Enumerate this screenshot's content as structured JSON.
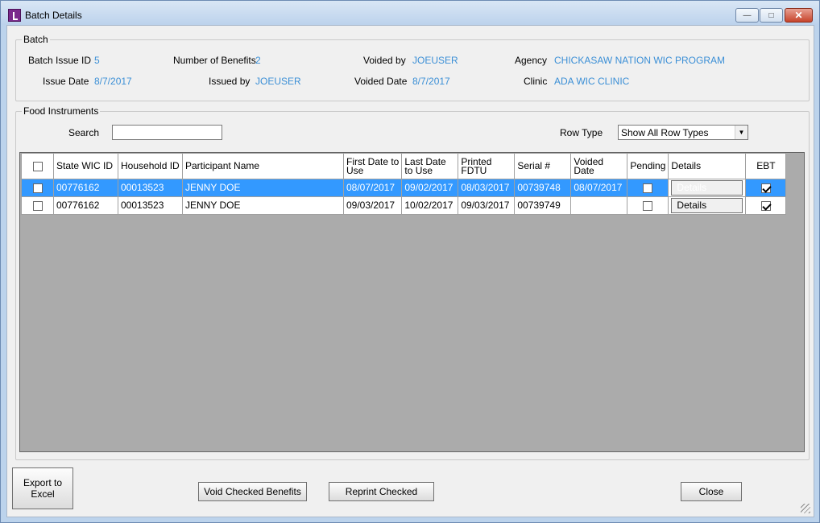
{
  "window": {
    "title": "Batch Details",
    "controls": {
      "minimize": "—",
      "maximize": "□",
      "close": "✕"
    }
  },
  "batch": {
    "group_label": "Batch",
    "batch_issue_id_label": "Batch Issue ID",
    "batch_issue_id": "5",
    "issue_date_label": "Issue Date",
    "issue_date": "8/7/2017",
    "number_of_benefits_label": "Number of Benefits",
    "number_of_benefits": "2",
    "issued_by_label": "Issued by",
    "issued_by": "JOEUSER",
    "voided_by_label": "Voided by",
    "voided_by": "JOEUSER",
    "voided_date_label": "Voided Date",
    "voided_date": "8/7/2017",
    "agency_label": "Agency",
    "agency": "CHICKASAW NATION WIC PROGRAM",
    "clinic_label": "Clinic",
    "clinic": "ADA WIC CLINIC"
  },
  "food_instruments": {
    "group_label": "Food Instruments",
    "search_label": "Search",
    "search_value": "",
    "row_type_label": "Row Type",
    "row_type_selected": "Show All Row Types"
  },
  "table": {
    "columns": {
      "state_wic_id": "State WIC ID",
      "household_id": "Household ID",
      "participant_name": "Participant Name",
      "first_date_to_use_1": "First Date to",
      "first_date_to_use_2": "Use",
      "last_date_to_use_1": "Last Date",
      "last_date_to_use_2": "to Use",
      "printed_fdtu_1": "Printed",
      "printed_fdtu_2": "FDTU",
      "serial": "Serial #",
      "voided_date_1": "Voided",
      "voided_date_2": "Date",
      "pending": "Pending",
      "details": "Details",
      "ebt": "EBT"
    },
    "rows": [
      {
        "selected": true,
        "checked": false,
        "state_wic_id": "00776162",
        "household_id": "00013523",
        "participant_name": "JENNY DOE",
        "first_date_to_use": "08/07/2017",
        "last_date_to_use": "09/02/2017",
        "printed_fdtu": "08/03/2017",
        "serial": "00739748",
        "voided_date": "08/07/2017",
        "pending": false,
        "details_label": "Details",
        "ebt": true
      },
      {
        "selected": false,
        "checked": false,
        "state_wic_id": "00776162",
        "household_id": "00013523",
        "participant_name": "JENNY DOE",
        "first_date_to_use": "09/03/2017",
        "last_date_to_use": "10/02/2017",
        "printed_fdtu": "09/03/2017",
        "serial": "00739749",
        "voided_date": "",
        "pending": false,
        "details_label": "Details",
        "ebt": true
      }
    ]
  },
  "buttons": {
    "export_excel_1": "Export to",
    "export_excel_2": "Excel",
    "void_checked": "Void Checked Benefits",
    "reprint_checked": "Reprint Checked",
    "close": "Close"
  }
}
